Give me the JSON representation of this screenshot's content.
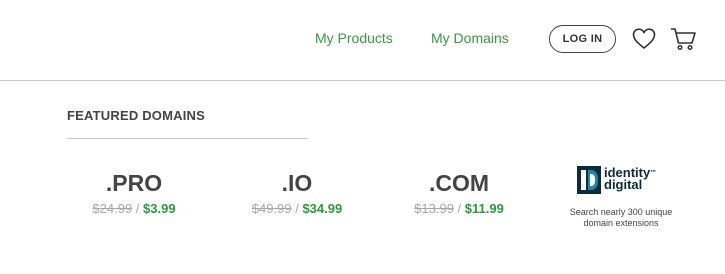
{
  "header": {
    "nav": {
      "products": "My Products",
      "domains": "My Domains"
    },
    "login_label": "LOG IN",
    "icons": {
      "wishlist": "heart-icon",
      "cart": "cart-icon"
    }
  },
  "featured": {
    "title": "FEATURED DOMAINS",
    "items": [
      {
        "tld": ".PRO",
        "old_price": "$24.99",
        "separator": "/",
        "new_price": "$3.99"
      },
      {
        "tld": ".IO",
        "old_price": "$49.99",
        "separator": "/",
        "new_price": "$34.99"
      },
      {
        "tld": ".COM",
        "old_price": "$13.99",
        "separator": "/",
        "new_price": "$11.99"
      }
    ],
    "partner": {
      "logo_line1": "identity",
      "logo_line2": "digital",
      "logo_tm": "™",
      "desc_line1": "Search nearly 300 unique",
      "desc_line2": "domain extensions"
    }
  },
  "colors": {
    "accent_green": "#3a9a3e",
    "price_green": "#2a9a3a",
    "strike_gray": "#a8a8a8",
    "logo_navy": "#0b2a3a",
    "logo_teal": "#1e8aa0"
  }
}
